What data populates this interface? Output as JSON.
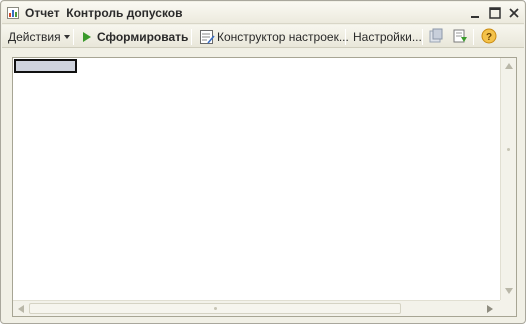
{
  "window": {
    "title": "Отчет  Контроль допусков",
    "title_icon": "report-icon",
    "controls": [
      "window-menu-icon",
      "maximize-icon",
      "close-icon"
    ]
  },
  "toolbar": {
    "actions_label": "Действия",
    "generate_label": "Сформировать",
    "constructor_label": "Конструктор настроек...",
    "settings_label": "Настройки...",
    "icons": [
      "restore-settings-icon",
      "save-settings-icon",
      "help-icon"
    ]
  },
  "colors": {
    "window_bg": "#f1f0e6",
    "selection_cell": "#cfd3dd",
    "play_green": "#3a9a2b",
    "help_orange": "#e8a317"
  }
}
